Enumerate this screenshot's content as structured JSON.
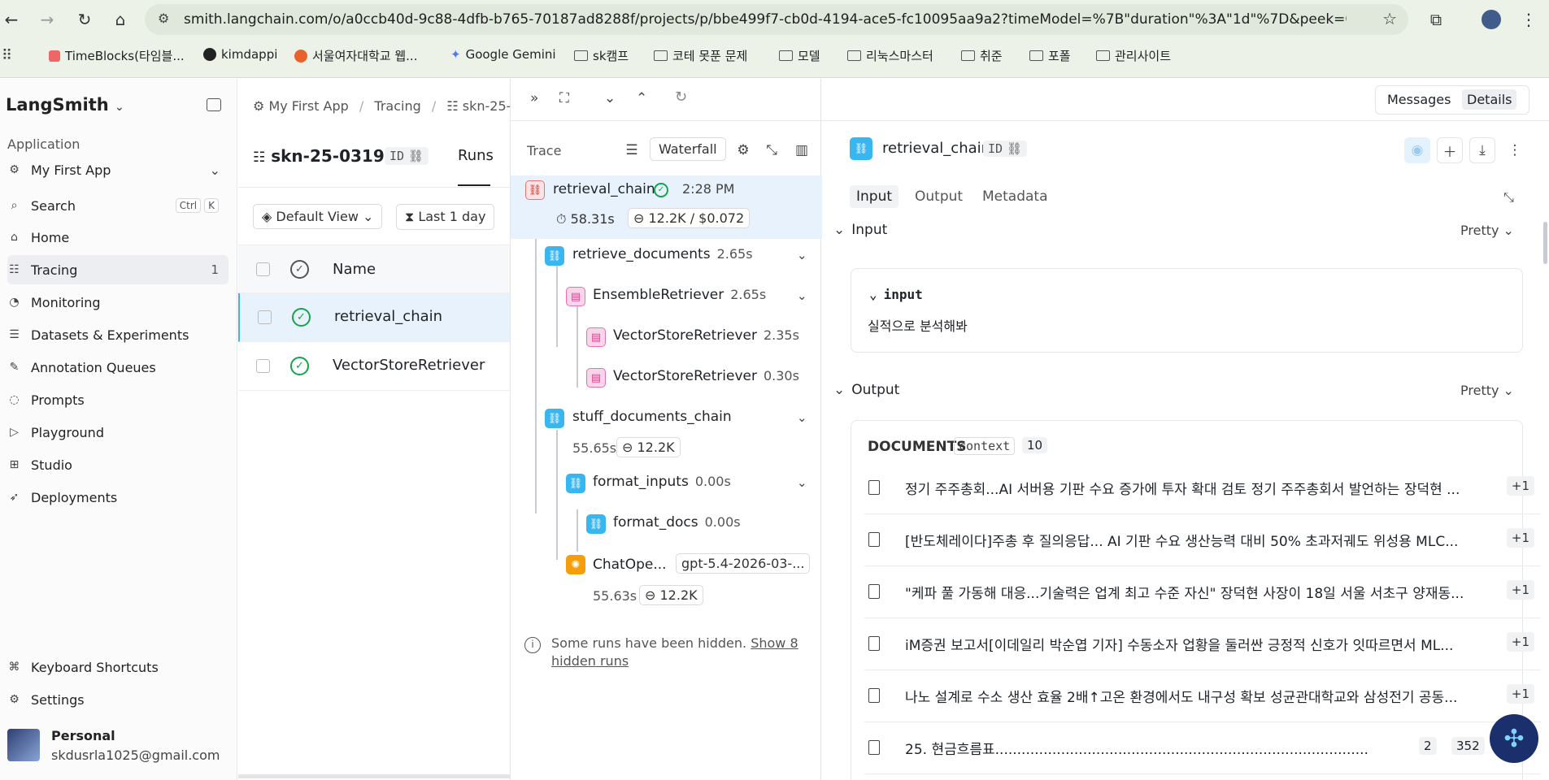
{
  "browser": {
    "url": "smith.langchain.com/o/a0ccb40d-9c88-4dfb-b765-70187ad8288f/projects/p/bbe499f7-cb0d-4194-ace5-fc10095aa9a2?timeModel=%7B\"duration\"%3A\"1d\"%7D&peek=019d0491-2e...",
    "bookmarks": [
      "TimeBlocks(타임블...",
      "kimdappi",
      "서울여자대학교 웹...",
      "Google Gemini",
      "sk캠프",
      "코테 못푼 문제",
      "모델",
      "리눅스마스터",
      "취준",
      "포폴",
      "관리사이트"
    ]
  },
  "sidebar": {
    "brand": "LangSmith",
    "section": "Application",
    "app_selector": "My First App",
    "search": "Search",
    "shortcut_ctrl": "Ctrl",
    "shortcut_k": "K",
    "items": [
      {
        "label": "Home"
      },
      {
        "label": "Tracing",
        "badge": "1"
      },
      {
        "label": "Monitoring"
      },
      {
        "label": "Datasets & Experiments"
      },
      {
        "label": "Annotation Queues"
      },
      {
        "label": "Prompts"
      },
      {
        "label": "Playground"
      },
      {
        "label": "Studio"
      },
      {
        "label": "Deployments"
      }
    ],
    "bottom": [
      "Keyboard Shortcuts",
      "Settings"
    ],
    "user": {
      "name": "Personal",
      "email": "skdusrla1025@gmail.com"
    }
  },
  "runs_panel": {
    "breadcrumb": [
      "My First App",
      "Tracing",
      "skn-25-"
    ],
    "project": "skn-25-0319",
    "id_label": "ID",
    "tab": "Runs",
    "view": "Default View",
    "timerange": "Last 1 day",
    "column": "Name",
    "rows": [
      "retrieval_chain",
      "VectorStoreRetriever"
    ]
  },
  "trace": {
    "label": "Trace",
    "view": "Waterfall",
    "root": {
      "name": "retrieval_chain",
      "time": "2:28 PM",
      "duration": "58.31s",
      "tokens": "12.2K / $0.072"
    },
    "nodes": [
      {
        "name": "retrieve_documents",
        "duration": "2.65s"
      },
      {
        "name": "EnsembleRetriever",
        "duration": "2.65s"
      },
      {
        "name": "VectorStoreRetriever",
        "duration": "2.35s"
      },
      {
        "name": "VectorStoreRetriever",
        "duration": "0.30s"
      },
      {
        "name": "stuff_documents_chain",
        "duration": "55.65s",
        "tokens": "12.2K"
      },
      {
        "name": "format_inputs",
        "duration": "0.00s"
      },
      {
        "name": "format_docs",
        "duration": "0.00s"
      },
      {
        "name": "ChatOpe...",
        "model": "gpt-5.4-2026-03-...",
        "duration": "55.63s",
        "tokens": "12.2K"
      }
    ],
    "hidden_note": "Some runs have been hidden.",
    "hidden_link": "Show 8",
    "hidden_link2": "hidden runs"
  },
  "details": {
    "toggle": [
      "Messages",
      "Details"
    ],
    "title": "retrieval_chain",
    "id_label": "ID",
    "tabs": [
      "Input",
      "Output",
      "Metadata"
    ],
    "input_section": "Input",
    "output_section": "Output",
    "pretty": "Pretty",
    "input_key": "input",
    "input_value": "실적으로 분석해봐",
    "documents_label": "DOCUMENTS",
    "context_label": "context",
    "count": "10",
    "docs": [
      {
        "text": "정기 주주총회...AI 서버용 기판 수요 증가에 투자 확대 검토 정기 주주총회서 발언하는 장덕현 ...",
        "extra": "+1"
      },
      {
        "text": "[반도체레이다]주총 후 질의응답... AI 기판 수요 생산능력 대비 50% 초과저궤도 위성용 MLC...",
        "extra": "+1"
      },
      {
        "text": "\"케파 풀 가동해 대응...기술력은 업계 최고 수준 자신\" 장덕현 사장이 18일 서울 서초구 양재동...",
        "extra": "+1"
      },
      {
        "text": "iM증권 보고서[이데일리 박순엽 기자] 수동소자 업황을 둘러싼 긍정적 신호가 잇따르면서 ML...",
        "extra": "+1"
      },
      {
        "text": "나노 설계로 수소 생산 효율 2배↑고온 환경에서도 내구성 확보 성균관대학교와 삼성전기 공동...",
        "extra": "+1"
      },
      {
        "text": "25. 현금흐름표.....................................................................................",
        "n1": "2",
        "n2": "352"
      }
    ]
  },
  "colors": {
    "accent": "#38b6f0",
    "success": "#16a34a",
    "selected": "#e8f2fc"
  }
}
